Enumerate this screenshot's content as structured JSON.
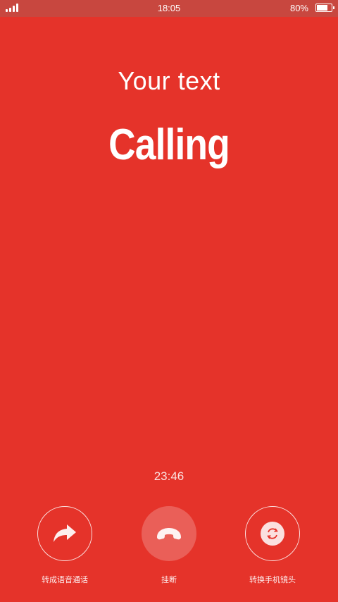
{
  "status_bar": {
    "time": "18:05",
    "battery_text": "80%",
    "battery_level": 0.8
  },
  "header": {
    "subtitle": "Your text",
    "title": "Calling"
  },
  "call": {
    "duration": "23:46"
  },
  "actions": [
    {
      "label": "转成语音通话",
      "icon": "forward-arrow-icon"
    },
    {
      "label": "挂断",
      "icon": "hang-up-icon"
    },
    {
      "label": "转换手机镜头",
      "icon": "camera-switch-icon"
    }
  ],
  "colors": {
    "background": "#e5332a",
    "status_bar": "#c8473f",
    "text": "#ffffff"
  }
}
